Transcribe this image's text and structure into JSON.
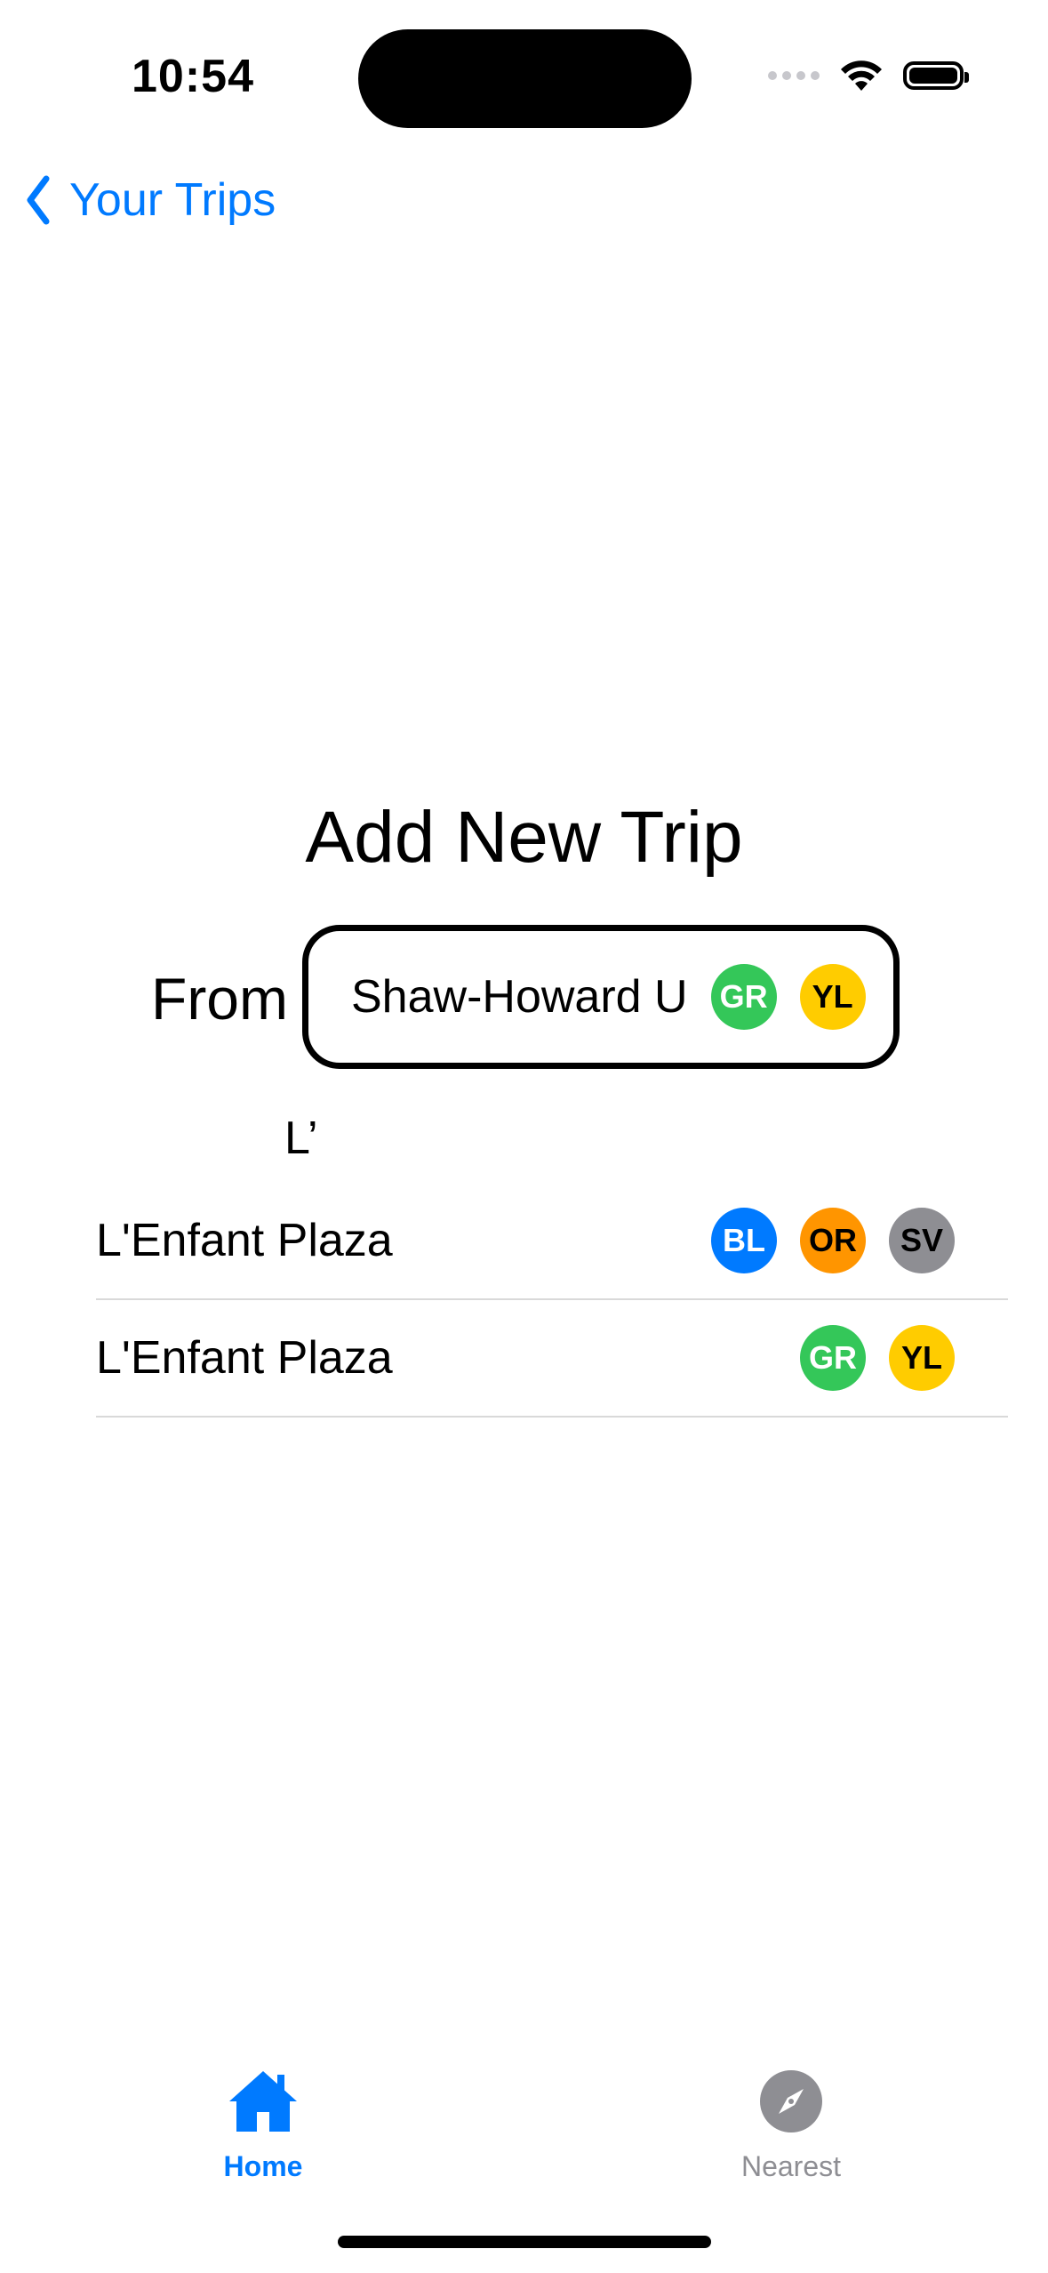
{
  "status_bar": {
    "time": "10:54"
  },
  "nav": {
    "back_label": "Your Trips"
  },
  "title": "Add New Trip",
  "from": {
    "label": "From",
    "station": "Shaw-Howard U",
    "lines": [
      {
        "code": "GR",
        "color": "#34c759",
        "text_color": "#ffffff"
      },
      {
        "code": "YL",
        "color": "#ffcc00",
        "text_color": "#000000"
      }
    ]
  },
  "to_input": {
    "value": "L’"
  },
  "results": [
    {
      "name": "L'Enfant Plaza",
      "lines": [
        {
          "code": "BL",
          "color": "#007aff",
          "text_color": "#ffffff"
        },
        {
          "code": "OR",
          "color": "#ff9500",
          "text_color": "#000000"
        },
        {
          "code": "SV",
          "color": "#8e8e93",
          "text_color": "#000000"
        }
      ]
    },
    {
      "name": "L'Enfant Plaza",
      "lines": [
        {
          "code": "GR",
          "color": "#34c759",
          "text_color": "#ffffff"
        },
        {
          "code": "YL",
          "color": "#ffcc00",
          "text_color": "#000000"
        }
      ]
    }
  ],
  "tabs": [
    {
      "label": "Home",
      "icon": "house-icon",
      "active": true
    },
    {
      "label": "Nearest",
      "icon": "compass-icon",
      "active": false
    }
  ],
  "colors": {
    "accent": "#007aff",
    "inactive": "#8e8e93"
  }
}
